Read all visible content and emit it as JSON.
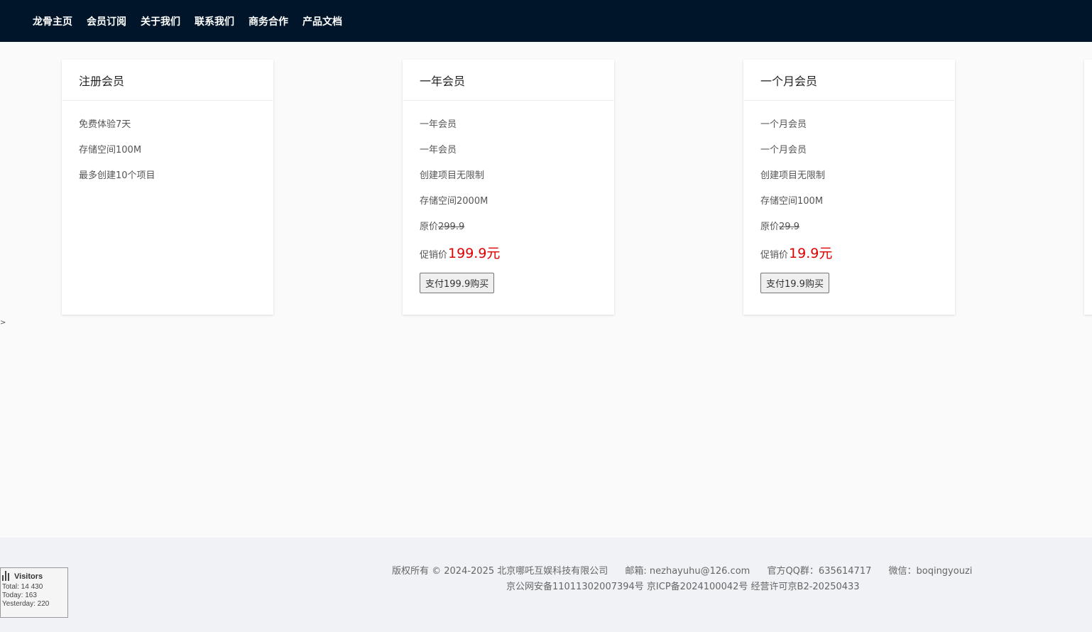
{
  "nav": {
    "items": [
      "龙骨主页",
      "会员订阅",
      "关于我们",
      "联系我们",
      "商务合作",
      "产品文档"
    ]
  },
  "cards": [
    {
      "title": "注册会员",
      "lines": [
        "免费体验7天",
        "存储空间100M",
        "最多创建10个项目"
      ]
    },
    {
      "title": "一年会员",
      "lines": [
        "一年会员",
        "一年会员",
        "创建项目无限制",
        "存储空间2000M"
      ],
      "original_label": "原价",
      "original_price": "299.9",
      "promo_label": "促销价",
      "promo_price": "199.9元",
      "button": "支付199.9购买"
    },
    {
      "title": "一个月会员",
      "lines": [
        "一个月会员",
        "一个月会员",
        "创建项目无限制",
        "存储空间100M"
      ],
      "original_label": "原价",
      "original_price": "29.9",
      "promo_label": "促销价",
      "promo_price": "19.9元",
      "button": "支付19.9购买"
    }
  ],
  "caret": ">",
  "footer": {
    "copyright": "版权所有 © 2024-2025 北京哪吒互娱科技有限公司",
    "email": "邮箱: nezhayuhu@126.com",
    "qq": "官方QQ群：635614717",
    "wechat": "微信：boqingyouzi",
    "license": "京公网安备11011302007394号 京ICP备2024100042号 经营许可京B2-20250433"
  },
  "visitors": {
    "title": "Visitors",
    "total": "Total: 14 430",
    "today": "Today: 163",
    "yesterday": "Yesterday: 220"
  }
}
